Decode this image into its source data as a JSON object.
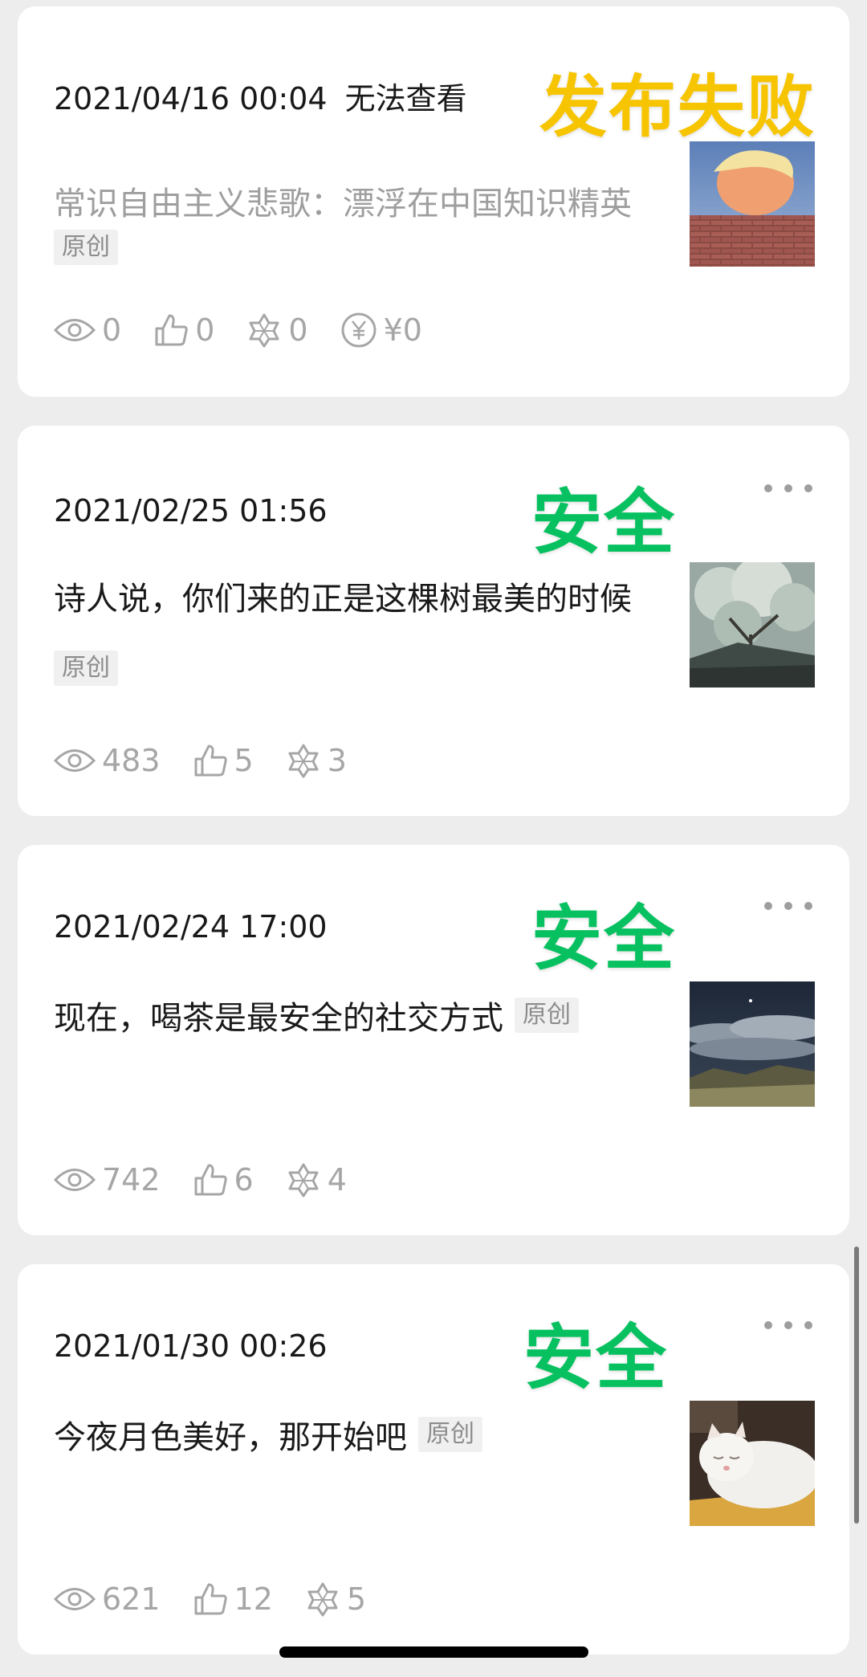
{
  "original_label": "原创",
  "overlay_colors": {
    "fail": "#f7c400",
    "safe": "#07c160"
  },
  "articles": [
    {
      "date": "2021/04/16 00:04",
      "status": "无法查看",
      "overlay": "发布失败",
      "title": "常识自由主义悲歌：漂浮在中国知识精英",
      "title_dimmed": true,
      "thumbnail": "portrait-behind-brick-wall",
      "stats": {
        "views": "0",
        "likes": "0",
        "wow": "0",
        "reward": "¥0"
      }
    },
    {
      "date": "2021/02/25 01:56",
      "overlay": "安全",
      "title": "诗人说，你们来的正是这棵树最美的时候",
      "thumbnail": "blossoming-tree-over-rooftop",
      "stats": {
        "views": "483",
        "likes": "5",
        "wow": "3"
      }
    },
    {
      "date": "2021/02/24 17:00",
      "overlay": "安全",
      "title": "现在，喝茶是最安全的社交方式",
      "thumbnail": "night-sky-clouds",
      "stats": {
        "views": "742",
        "likes": "6",
        "wow": "4"
      }
    },
    {
      "date": "2021/01/30 00:26",
      "overlay": "安全",
      "title": "今夜月色美好，那开始吧",
      "thumbnail": "sleeping-white-cat",
      "stats": {
        "views": "621",
        "likes": "12",
        "wow": "5"
      }
    }
  ]
}
